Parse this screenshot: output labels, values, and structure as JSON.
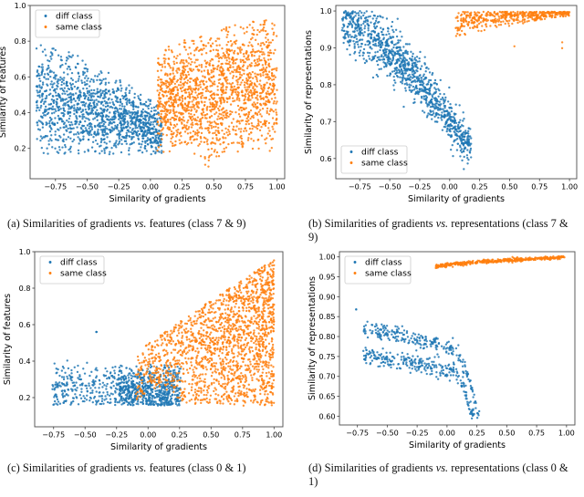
{
  "figure": {
    "title": "",
    "colors": {
      "diff_class": "#1f77b4",
      "same_class": "#ff7f0e",
      "axis": "#000000",
      "spine": "#333333",
      "legend_border": "#cccccc",
      "background": "#ffffff"
    },
    "legend_labels": {
      "diff": "diff class",
      "same": "same class"
    }
  },
  "captions": {
    "a": {
      "tag": "(a)",
      "pre": "Similarities of gradients ",
      "it": "vs.",
      "post": " features (class 7 & 9)"
    },
    "b": {
      "tag": "(b)",
      "pre": "Similarities of gradients ",
      "it": "vs.",
      "post": " representations (class 7 & 9)"
    },
    "c": {
      "tag": "(c)",
      "pre": "Similarities of gradients ",
      "it": "vs.",
      "post": " features (class 0 & 1)"
    },
    "d": {
      "tag": "(d)",
      "pre": "Similarities of gradients ",
      "it": "vs.",
      "post": " representations (class 0 & 1)"
    }
  },
  "chart_data": [
    {
      "id": "a",
      "type": "scatter",
      "title": "",
      "xlabel": "Similarity of gradients",
      "ylabel": "Similarity of features",
      "xlim": [
        -0.95,
        1.06
      ],
      "ylim": [
        0.03,
        1.0
      ],
      "xticks": [
        -0.75,
        -0.5,
        -0.25,
        0.0,
        0.25,
        0.5,
        0.75,
        1.0
      ],
      "xticklabels": [
        "−0.75",
        "−0.50",
        "−0.25",
        "0.00",
        "0.25",
        "0.50",
        "0.75",
        "1.00"
      ],
      "yticks": [
        0.2,
        0.4,
        0.6,
        0.8,
        1.0
      ],
      "yticklabels": [
        "0.2",
        "0.4",
        "0.6",
        "0.8",
        "1.0"
      ],
      "grid": false,
      "legend_position": "upper left",
      "series": [
        {
          "name": "diff class",
          "color": "#1f77b4",
          "n_points": 1400,
          "cluster": {
            "x_range": [
              -0.9,
              0.08
            ],
            "y_range": [
              0.08,
              0.82
            ],
            "x_mean": -0.42,
            "y_mean": 0.5,
            "shape": "descending-then-narrowing band; upper envelope falls from 0.80 at x=-0.88 to 0.42 at x=0.02; lower envelope near 0.18 across, dipping to 0.08 at x=0.00"
          }
        },
        {
          "name": "same class",
          "color": "#ff7f0e",
          "n_points": 1600,
          "cluster": {
            "x_range": [
              0.06,
              1.0
            ],
            "y_range": [
              0.09,
              0.95
            ],
            "x_mean": 0.6,
            "y_mean": 0.52,
            "shape": "broad vertical band widening right; upper envelope rises 0.72 at x=0.08 to 0.93 at x=0.97; lower envelope about 0.18, dipping to 0.09 near x=0.46"
          }
        }
      ]
    },
    {
      "id": "b",
      "type": "scatter",
      "title": "",
      "xlabel": "Similarity of gradients",
      "ylabel": "Similarity of representations",
      "xlim": [
        -0.95,
        1.06
      ],
      "ylim": [
        0.545,
        1.015
      ],
      "xticks": [
        -0.75,
        -0.5,
        -0.25,
        0.0,
        0.25,
        0.5,
        0.75,
        1.0
      ],
      "xticklabels": [
        "−0.75",
        "−0.50",
        "−0.25",
        "0.00",
        "0.25",
        "0.50",
        "0.75",
        "1.00"
      ],
      "yticks": [
        0.6,
        0.7,
        0.8,
        0.9,
        1.0
      ],
      "yticklabels": [
        "0.6",
        "0.7",
        "0.8",
        "0.9",
        "1.0"
      ],
      "grid": false,
      "legend_position": "lower left",
      "series": [
        {
          "name": "diff class",
          "color": "#1f77b4",
          "n_points": 1100,
          "cluster": {
            "x_range": [
              -0.9,
              0.18
            ],
            "y_range": [
              0.56,
              1.0
            ],
            "x_mean": -0.4,
            "y_mean": 0.86,
            "shape": "downward diagonal band from (-0.88, 0.98) to (0.16, 0.62); spread about 0.07 wide; tail drops to 0.56 near x=0.17"
          }
        },
        {
          "name": "same class",
          "color": "#ff7f0e",
          "n_points": 460,
          "cluster": {
            "x_range": [
              0.05,
              1.0
            ],
            "y_range": [
              0.88,
              1.0
            ],
            "x_mean": 0.6,
            "y_mean": 0.975,
            "shape": "narrow rising band hugging the top; lower envelope climbs from 0.90 at x=0.08 to 0.985 at x=0.95; a few outliers near 0.88-0.92"
          }
        }
      ]
    },
    {
      "id": "c",
      "type": "scatter",
      "title": "",
      "xlabel": "Similarity of gradients",
      "ylabel": "Similarity of features",
      "xlim": [
        -0.9,
        1.07
      ],
      "ylim": [
        0.04,
        1.0
      ],
      "xticks": [
        -0.75,
        -0.5,
        -0.25,
        0.0,
        0.25,
        0.5,
        0.75,
        1.0
      ],
      "xticklabels": [
        "−0.75",
        "−0.50",
        "−0.25",
        "0.00",
        "0.25",
        "0.50",
        "0.75",
        "1.00"
      ],
      "yticks": [
        0.2,
        0.4,
        0.6,
        0.8,
        1.0
      ],
      "yticklabels": [
        "0.2",
        "0.4",
        "0.6",
        "0.8",
        "1.0"
      ],
      "grid": false,
      "legend_position": "upper left",
      "series": [
        {
          "name": "diff class",
          "color": "#1f77b4",
          "n_points": 900,
          "cluster": {
            "x_range": [
              -0.76,
              0.26
            ],
            "y_range": [
              0.07,
              0.45
            ],
            "x_mean": -0.08,
            "y_mean": 0.25,
            "shape": "low flat band; dense core between x=-0.2 and 0.25 with y 0.10-0.40; sparser tail left to x=-0.76; one isolated point near (-0.41, 0.56)"
          }
        },
        {
          "name": "same class",
          "color": "#ff7f0e",
          "n_points": 1700,
          "cluster": {
            "x_range": [
              -0.1,
              1.0
            ],
            "y_range": [
              0.11,
              0.95
            ],
            "x_mean": 0.63,
            "y_mean": 0.49,
            "shape": "wedge widening to the right; upper envelope rises from 0.45 at x=-0.08 to 0.95 at x=0.97; lower envelope near 0.15; narrow neck around x=0.3"
          }
        }
      ]
    },
    {
      "id": "d",
      "type": "scatter",
      "title": "",
      "xlabel": "Similarity of gradients",
      "ylabel": "Similarity of representations",
      "xlim": [
        -0.9,
        1.07
      ],
      "ylim": [
        0.578,
        1.013
      ],
      "xticks": [
        -0.75,
        -0.5,
        -0.25,
        0.0,
        0.25,
        0.5,
        0.75,
        1.0
      ],
      "xticklabels": [
        "−0.75",
        "−0.50",
        "−0.25",
        "0.00",
        "0.25",
        "0.50",
        "0.75",
        "1.00"
      ],
      "yticks": [
        0.6,
        0.65,
        0.7,
        0.75,
        0.8,
        0.85,
        0.9,
        0.95,
        1.0
      ],
      "yticklabels": [
        "0.60",
        "0.65",
        "0.70",
        "0.75",
        "0.80",
        "0.85",
        "0.90",
        "0.95",
        "1.00"
      ],
      "grid": false,
      "legend_position": "upper left",
      "series": [
        {
          "name": "diff class",
          "color": "#1f77b4",
          "n_points": 520,
          "cluster": {
            "x_range": [
              -0.76,
              0.27
            ],
            "y_range": [
              0.597,
              0.868
            ],
            "x_mean": -0.18,
            "y_mean": 0.725,
            "shape": "two descending stripes; upper stripe from (-0.68, 0.82) to (0.10, 0.76), lower stripe from (-0.58, 0.75) to (0.10, 0.70); both bend steeply down to 0.60 by x=0.24; isolated point at (-0.76, 0.868)"
          }
        },
        {
          "name": "same class",
          "color": "#ff7f0e",
          "n_points": 420,
          "cluster": {
            "x_range": [
              -0.1,
              0.99
            ],
            "y_range": [
              0.968,
              1.0
            ],
            "x_mean": 0.5,
            "y_mean": 0.992,
            "shape": "very tight near-flat band just under 1.00; rises from 0.972 at x=-0.09 to 0.999 at x=0.95"
          }
        }
      ]
    }
  ]
}
